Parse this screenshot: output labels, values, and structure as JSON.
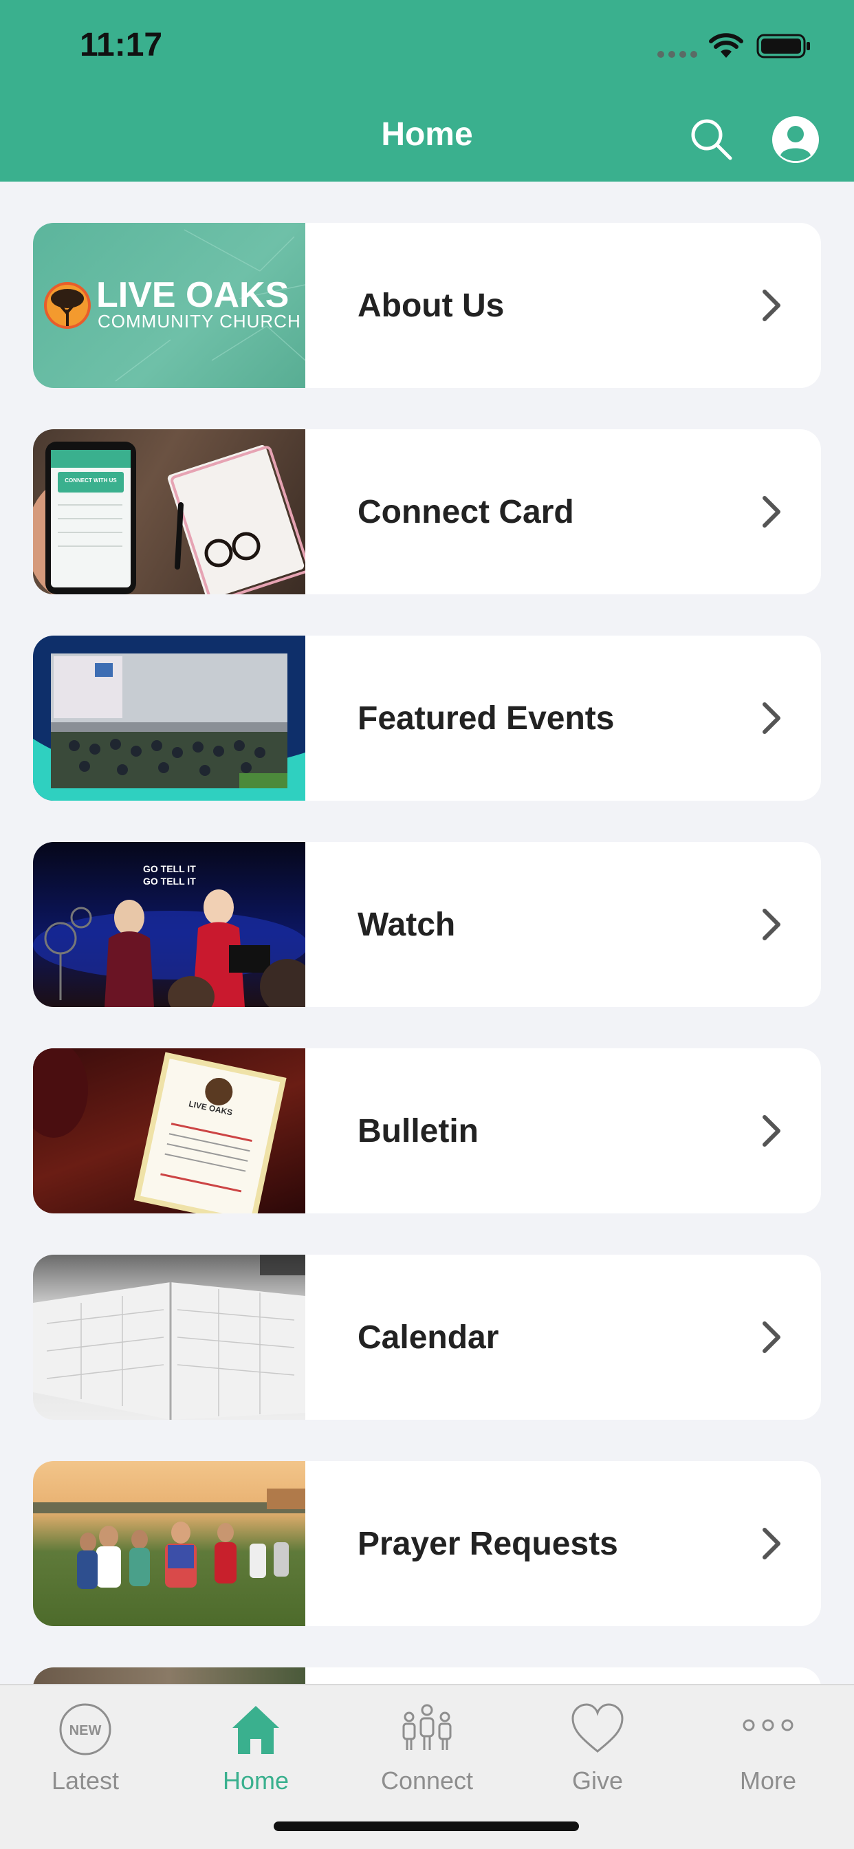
{
  "status_bar": {
    "time": "11:17"
  },
  "header": {
    "title": "Home"
  },
  "menu": [
    {
      "label": "About Us",
      "thumb_logo_line1": "LIVE OAKS",
      "thumb_logo_line2": "COMMUNITY CHURCH",
      "thumb_caption": ""
    },
    {
      "label": "Connect Card",
      "thumb_logo_line1": "",
      "thumb_logo_line2": "",
      "thumb_caption": "CONNECT WITH US"
    },
    {
      "label": "Featured Events",
      "thumb_logo_line1": "",
      "thumb_logo_line2": "",
      "thumb_caption": ""
    },
    {
      "label": "Watch",
      "thumb_logo_line1": "",
      "thumb_logo_line2": "",
      "thumb_caption": "GO TELL IT\nGO TELL IT"
    },
    {
      "label": "Bulletin",
      "thumb_logo_line1": "LIVE OAKS",
      "thumb_logo_line2": "",
      "thumb_caption": ""
    },
    {
      "label": "Calendar",
      "thumb_logo_line1": "",
      "thumb_logo_line2": "",
      "thumb_caption": ""
    },
    {
      "label": "Prayer Requests",
      "thumb_logo_line1": "",
      "thumb_logo_line2": "",
      "thumb_caption": ""
    }
  ],
  "tabs": [
    {
      "label": "Latest",
      "icon": "new-badge-icon",
      "icon_text": "NEW",
      "active": false
    },
    {
      "label": "Home",
      "icon": "home-icon",
      "active": true
    },
    {
      "label": "Connect",
      "icon": "people-icon",
      "active": false
    },
    {
      "label": "Give",
      "icon": "heart-icon",
      "active": false
    },
    {
      "label": "More",
      "icon": "more-dots-icon",
      "active": false
    }
  ],
  "colors": {
    "header_bg": "#3ab08e",
    "accent": "#3ab08e",
    "page_bg": "#f2f3f7",
    "card_bg": "#ffffff",
    "tab_inactive": "#8e8e8e"
  }
}
